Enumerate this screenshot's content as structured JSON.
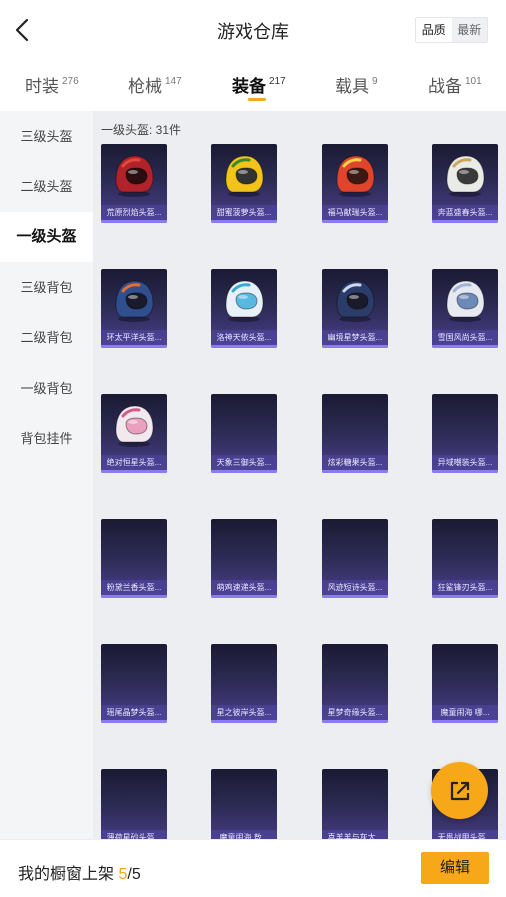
{
  "header": {
    "title": "游戏仓库",
    "sort_quality": "品质",
    "sort_newest": "最新"
  },
  "tabs": [
    {
      "label": "时装",
      "count": "276"
    },
    {
      "label": "枪械",
      "count": "147"
    },
    {
      "label": "装备",
      "count": "217"
    },
    {
      "label": "载具",
      "count": "9"
    },
    {
      "label": "战备",
      "count": "101"
    }
  ],
  "active_tab": "装备",
  "sidebar": [
    {
      "label": "三级头盔"
    },
    {
      "label": "二级头盔"
    },
    {
      "label": "一级头盔"
    },
    {
      "label": "三级背包"
    },
    {
      "label": "二级背包"
    },
    {
      "label": "一级背包"
    },
    {
      "label": "背包挂件"
    }
  ],
  "active_sidebar": "一级头盔",
  "content": {
    "count_label": "一级头盔: 31件"
  },
  "items": [
    {
      "name": "荒原烈焰头盔...",
      "helmet": {
        "shell": "#b0232b",
        "accent": "#e04a3a",
        "visor": "#2a0d10"
      }
    },
    {
      "name": "甜蜜菠萝头盔...",
      "helmet": {
        "shell": "#f2c31b",
        "accent": "#3a8c2a",
        "visor": "#333333"
      }
    },
    {
      "name": "福马献瑞头盔...",
      "helmet": {
        "shell": "#e0442a",
        "accent": "#f3d34a",
        "visor": "#3a1a12"
      }
    },
    {
      "name": "奔蓝盛春头盔...",
      "helmet": {
        "shell": "#e9ebe6",
        "accent": "#c9a85a",
        "visor": "#3a3a3a"
      }
    },
    {
      "name": "环太平洋头盔...",
      "helmet": {
        "shell": "#2f4f8f",
        "accent": "#f06a2a",
        "visor": "#1a1a2a"
      }
    },
    {
      "name": "洛神天依头盔...",
      "helmet": {
        "shell": "#e8f1f8",
        "accent": "#3aa7d8",
        "visor": "#58b8e0"
      }
    },
    {
      "name": "幽境星梦头盔...",
      "helmet": {
        "shell": "#2b3b6a",
        "accent": "#cfd8f0",
        "visor": "#1a1a2a"
      }
    },
    {
      "name": "雪国风尚头盔...",
      "helmet": {
        "shell": "#e6e9f0",
        "accent": "#9fb4d8",
        "visor": "#6d89b8"
      }
    },
    {
      "name": "绝对恒星头盔...",
      "helmet": {
        "shell": "#f2e9ee",
        "accent": "#d05a88",
        "visor": "#e8a0be"
      }
    },
    {
      "name": "天象三御头盔...",
      "helmet": null
    },
    {
      "name": "炫彩糖果头盔...",
      "helmet": null
    },
    {
      "name": "异域嘲装头盔...",
      "helmet": null
    },
    {
      "name": "粉黛兰香头盔...",
      "helmet": null
    },
    {
      "name": "萌鸡速递头盔...",
      "helmet": null
    },
    {
      "name": "风迹短诗头盔...",
      "helmet": null
    },
    {
      "name": "狂鲨锋刃头盔...",
      "helmet": null
    },
    {
      "name": "瑶尾晶梦头盔...",
      "helmet": null
    },
    {
      "name": "星之彼岸头盔...",
      "helmet": null
    },
    {
      "name": "星梦奇缘头盔...",
      "helmet": null
    },
    {
      "name": "魔童闹海 哪...",
      "helmet": null
    },
    {
      "name": "薄荷星砂头盔...",
      "helmet": null
    },
    {
      "name": "魔童闹海 敖...",
      "helmet": null
    },
    {
      "name": "喜羊羊与灰太...",
      "helmet": null
    },
    {
      "name": "无畏战甲头盔...",
      "helmet": null
    }
  ],
  "footer": {
    "label_prefix": "我的橱窗上架 ",
    "shelf_used": "5",
    "shelf_sep": "/",
    "shelf_total": "5",
    "edit_label": "编辑"
  },
  "colors": {
    "accent": "#f6a818",
    "card_top": "#1a1a33",
    "card_bottom": "#4b3f8c"
  }
}
